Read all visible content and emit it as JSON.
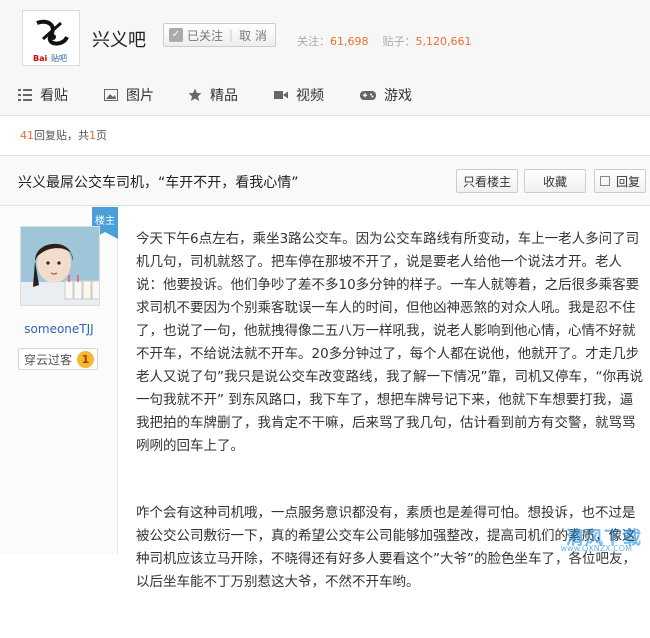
{
  "forum": {
    "name": "兴义吧",
    "logo_text": "Bai 贴吧",
    "follow_label": "已关注",
    "unfollow_label": "取 消",
    "stats_followers_label": "关注：",
    "stats_followers": "61,698",
    "stats_posts_label": "贴子：",
    "stats_posts": "5,120,661"
  },
  "tabs": [
    {
      "label": "看贴",
      "icon": "list-icon"
    },
    {
      "label": "图片",
      "icon": "image-icon"
    },
    {
      "label": "精品",
      "icon": "star-icon"
    },
    {
      "label": "视频",
      "icon": "video-icon"
    },
    {
      "label": "游戏",
      "icon": "gamepad-icon"
    }
  ],
  "thread": {
    "reply_count": "41",
    "reply_text": "回复贴，共",
    "page_count": "1",
    "page_text": "页",
    "title": "兴义最屌公交车司机，“车开不开，看我心情”",
    "btn_only_op": "只看楼主",
    "btn_favorite": "收藏",
    "btn_reply": "回复"
  },
  "author": {
    "badge": "楼主",
    "username": "someoneTJJ",
    "level_name": "穿云过客",
    "level_num": "1"
  },
  "post": {
    "paragraph1": "今天下午6点左右，乘坐3路公交车。因为公交车路线有所变动，车上一老人多问了司机几句，司机就怒了。把车停在那坡不开了，说是要老人给他一个说法才开。老人说：他要投诉。他们争吵了差不多10多分钟的样子。一车人就等着，之后很多乘客要求司机不要因为个别乘客耽误一车人的时间，但他凶神恶煞的对众人吼。我是忍不住了，也说了一句，他就拽得像二五八万一样吼我，说老人影响到他心情，心情不好就不开车，不给说法就不开车。20多分钟过了，每个人都在说他，他就开了。才走几步老人又说了句”我只是说公交车改变路线，我了解一下情况”靠，司机又停车，“你再说一句我就不开” 到东风路口，我下车了，想把车牌号记下来，他就下车想要打我，逼我把拍的车牌删了，我肯定不干嘛，后来骂了我几句，估计看到前方有交警，就骂骂咧咧的回车上了。",
    "paragraph2": "咋个会有这种司机哦，一点服务意识都没有，素质也是差得可怕。想投诉，也不过是被公交公司敷衍一下，真的希望公交车公司能够加强整改，提高司机们的素质，像这种司机应该立马开除，不晓得还有好多人要看这个”大爷”的脸色坐车了，各位吧友，以后坐车能不丁万别惹这大爷，不然不开车哟。"
  },
  "watermark": {
    "text": "清风下载",
    "url": "www.QXNZX.COM"
  },
  "colors": {
    "accent": "#e8702a",
    "link": "#2d64b3",
    "badge": "#4a9fd8"
  }
}
